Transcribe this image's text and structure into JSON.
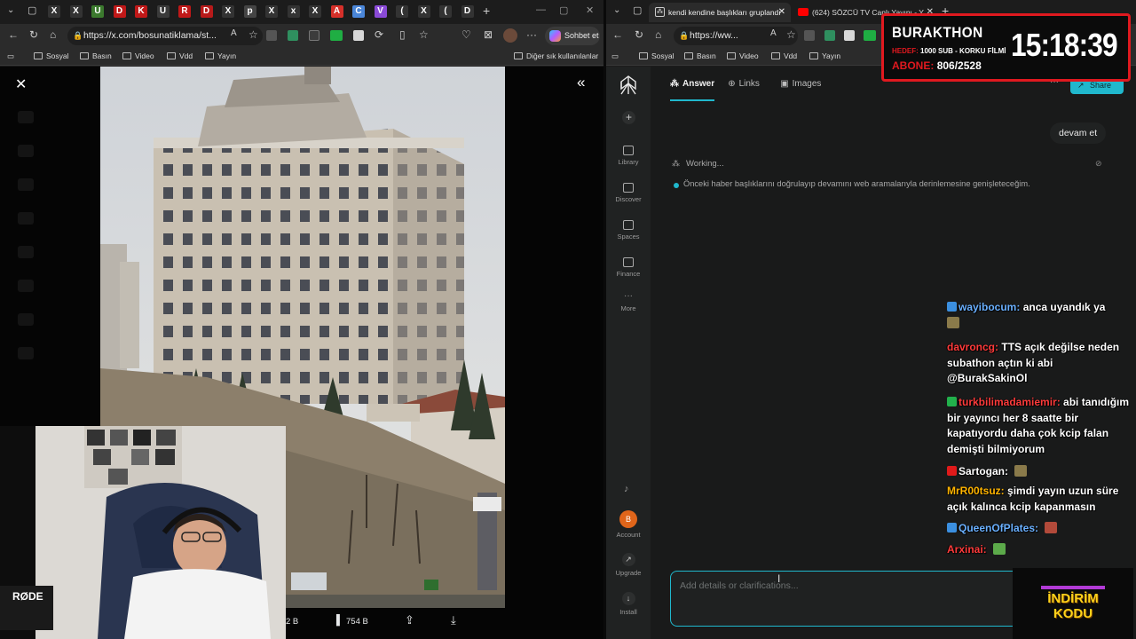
{
  "left_browser": {
    "tab_letters": [
      "X",
      "X",
      "U",
      "D",
      "K",
      "U",
      "R",
      "D",
      "X",
      "p",
      "X",
      "x",
      "X",
      "A",
      "C",
      "V",
      "(",
      "X",
      "(",
      "D"
    ],
    "url": "https://x.com/bosunatiklama/st...",
    "copilot_label": "Sohbet et",
    "bookmarks": [
      "Sosyal",
      "Basın",
      "Video",
      "Vdd",
      "Yayın"
    ],
    "other_bookmarks": "Diğer sık kullanılanlar",
    "tweet_views": "754 B",
    "tweet_count_partial": "2 B"
  },
  "right_browser": {
    "tabs": [
      {
        "title": "kendi kendine başlıkları gruplandı"
      },
      {
        "title": "(624) SÖZCÜ TV Canlı Yayını - Y"
      }
    ],
    "url": "https://ww...",
    "bookmarks": [
      "Sosyal",
      "Basın",
      "Video",
      "Vdd",
      "Yayın"
    ]
  },
  "perplexity": {
    "nav": [
      {
        "label": "Answer",
        "icon": "answer-icon",
        "active": true
      },
      {
        "label": "Links",
        "icon": "globe-icon",
        "active": false
      },
      {
        "label": "Images",
        "icon": "image-icon",
        "active": false
      }
    ],
    "share_label": "Share",
    "sidebar": [
      {
        "label": "Library",
        "icon": "library-icon"
      },
      {
        "label": "Discover",
        "icon": "discover-icon"
      },
      {
        "label": "Spaces",
        "icon": "spaces-icon"
      },
      {
        "label": "Finance",
        "icon": "finance-icon"
      },
      {
        "label": "More",
        "icon": "more-icon"
      }
    ],
    "bottom_sidebar": [
      {
        "label": "Account",
        "icon": "avatar-icon"
      },
      {
        "label": "Upgrade",
        "icon": "upgrade-icon"
      },
      {
        "label": "Install",
        "icon": "install-icon"
      }
    ],
    "account_initial": "B",
    "user_message": "devam et",
    "working_label": "Working...",
    "step_text": "Önceki haber başlıklarını doğrulayıp devamını web aramalarıyla derinlemesine genişleteceğim.",
    "input_placeholder": "Add details or clarifications..."
  },
  "overlay": {
    "title": "BURAKTHON",
    "target_label": "HEDEF:",
    "target_text": "1000 SUB - KORKU FİLMİ",
    "subs_label": "ABONE:",
    "subs_value": "806/2528",
    "clock": "15:18:39",
    "promo": [
      "İNDİRİM",
      "KODU"
    ]
  },
  "chat": [
    {
      "user": "wayibocum",
      "color": "#6ab0ff",
      "text": "anca uyandık ya"
    },
    {
      "user": "davroncg",
      "color": "#ff3b3b",
      "text": "TTS açık değilse neden subathon açtın ki abi @BurakSakinOl"
    },
    {
      "user": "turkbilimadamiemir",
      "color": "#ff3b3b",
      "text": "abi tanıdığım bir yayıncı her 8 saatte bir kapatıyordu daha çok kcip falan demişti bilmiyorum"
    },
    {
      "user": "Sartogan",
      "color": "#ffffff",
      "text": ""
    },
    {
      "user": "MrR00tsuz",
      "color": "#ffb400",
      "text": "şimdi yayın uzun süre açık kalınca kcip kapanmasın"
    },
    {
      "user": "QueenOfPlates",
      "color": "#6ab0ff",
      "text": ""
    },
    {
      "user": "Arxinai",
      "color": "#ff3b3b",
      "text": ""
    }
  ],
  "colors": {
    "accent_teal": "#20b8cd",
    "overlay_red": "#e0191f",
    "promo_yellow": "#ffd21a"
  }
}
